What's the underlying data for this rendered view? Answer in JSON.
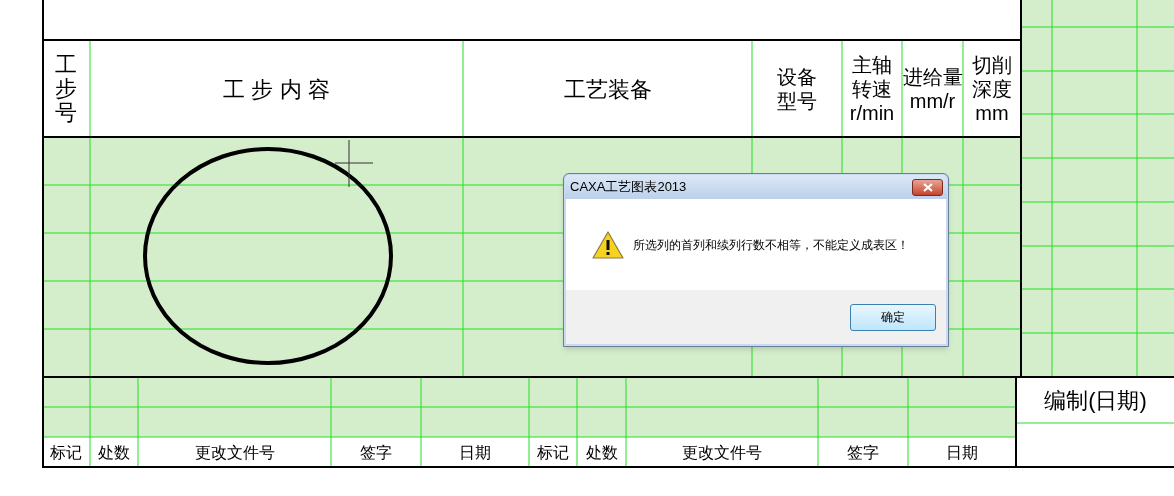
{
  "process_table": {
    "header_cells": [
      {
        "kind": "vertical",
        "text": "工步号"
      },
      {
        "kind": "spaced",
        "text": "工 步 内 容"
      },
      {
        "kind": "single",
        "text": "工艺装备"
      },
      {
        "kind": "lines",
        "lines": [
          "设备",
          "型号"
        ]
      },
      {
        "kind": "lines",
        "lines": [
          "主轴",
          "转速",
          "r/min"
        ]
      },
      {
        "kind": "lines",
        "lines": [
          "进给量",
          "mm/r"
        ]
      },
      {
        "kind": "lines",
        "lines": [
          "切削",
          "深度",
          "mm"
        ]
      }
    ]
  },
  "revision_block": {
    "labels": [
      "标记",
      "处数",
      "更改文件号",
      "签字",
      "日期",
      "标记",
      "处数",
      "更改文件号",
      "签字",
      "日期"
    ],
    "compiled_label": "编制(日期)"
  },
  "dialog": {
    "title": "CAXA工艺图表2013",
    "message": "所选列的首列和续列行数不相等，不能定义成表区！",
    "buttons": [
      "确定"
    ]
  }
}
